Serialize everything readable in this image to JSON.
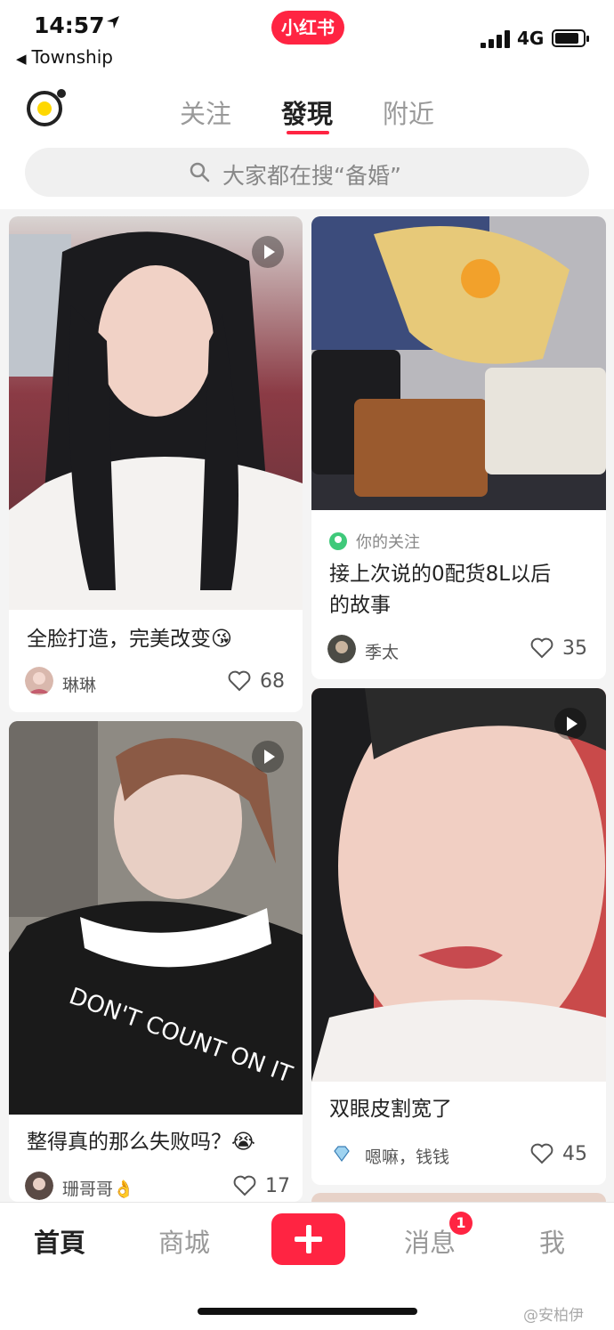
{
  "status_bar": {
    "time": "14:57",
    "back_app": "Township",
    "network": "4G",
    "brand": "小红书"
  },
  "tabs": [
    {
      "label": "关注"
    },
    {
      "label": "發現"
    },
    {
      "label": "附近"
    }
  ],
  "search": {
    "placeholder": "大家都在搜“备婚”"
  },
  "feed": [
    {
      "title": "全脸打造，完美改变😘",
      "author": "琳琳",
      "likes": "68",
      "video": true
    },
    {
      "follow_tag": "你的关注",
      "title_line1": "接上次说的0配货8L以后",
      "title_line2": "的故事",
      "author": "季太",
      "likes": "35",
      "video": false
    },
    {
      "title": "整得真的那么失败吗？😭",
      "author": "珊哥哥👌",
      "likes": "17",
      "video": true
    },
    {
      "title": "双眼皮割宽了",
      "author": "嗯嘛，钱钱",
      "likes": "45",
      "video": true
    }
  ],
  "bottom_nav": [
    {
      "label": "首頁"
    },
    {
      "label": "商城"
    },
    {
      "label": "消息",
      "badge": "1"
    },
    {
      "label": "我"
    }
  ],
  "watermark": "@安柏伊",
  "colors": {
    "accent": "#ff2442",
    "camera_core": "#ffd800",
    "follow_dot": "#3fc97a"
  }
}
